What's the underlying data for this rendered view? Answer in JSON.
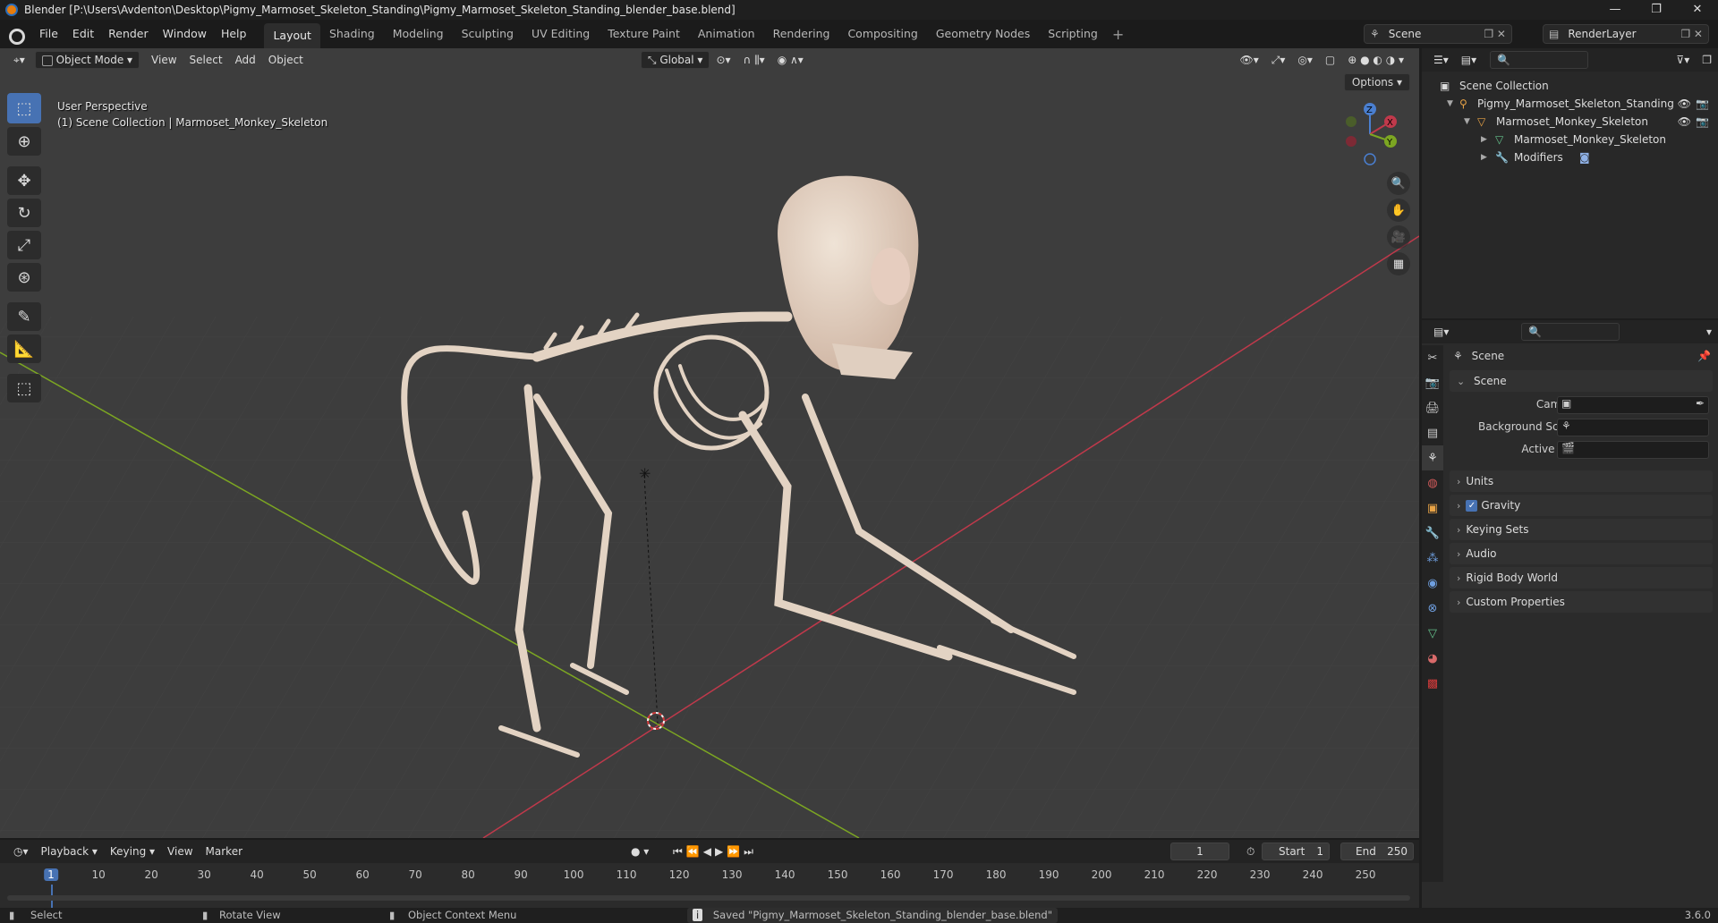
{
  "titlebar": {
    "title": "Blender [P:\\Users\\Avdenton\\Desktop\\Pigmy_Marmoset_Skeleton_Standing\\Pigmy_Marmoset_Skeleton_Standing_blender_base.blend]",
    "minimize": "—",
    "maximize": "❐",
    "close": "✕"
  },
  "menu": {
    "file": "File",
    "edit": "Edit",
    "render": "Render",
    "window": "Window",
    "help": "Help"
  },
  "workspaces": [
    "Layout",
    "Shading",
    "Modeling",
    "Sculpting",
    "UV Editing",
    "Texture Paint",
    "Animation",
    "Rendering",
    "Compositing",
    "Geometry Nodes",
    "Scripting"
  ],
  "active_workspace": "Layout",
  "scene_selector": {
    "scene": "Scene",
    "view_layer": "RenderLayer"
  },
  "viewport": {
    "mode": "Object Mode",
    "menus": [
      "View",
      "Select",
      "Add",
      "Object"
    ],
    "transform_orientation": "Global",
    "options": "Options",
    "perspective_label": "User Perspective",
    "collection_label": "(1) Scene Collection | Marmoset_Monkey_Skeleton",
    "gizmo_axes": {
      "x": "X",
      "y": "Y",
      "z": "Z"
    },
    "colors": {
      "background": "#3d3d3d",
      "x_axis": "#c0394b",
      "y_axis": "#7ca622",
      "active_tool": "#4772b3"
    }
  },
  "tool_icons": [
    "select-box-icon",
    "cursor-icon",
    "move-icon",
    "rotate-icon",
    "scale-icon",
    "transform-icon",
    "annotate-icon",
    "measure-icon",
    "add-cube-icon"
  ],
  "outliner": {
    "root": "Scene Collection",
    "items": [
      {
        "label": "Pigmy_Marmoset_Skeleton_Standing",
        "type": "armature"
      },
      {
        "label": "Marmoset_Monkey_Skeleton",
        "type": "object"
      },
      {
        "label": "Marmoset_Monkey_Skeleton",
        "type": "mesh-data"
      },
      {
        "label": "Modifiers",
        "type": "modifiers"
      }
    ]
  },
  "properties": {
    "context": "Scene",
    "panel": "Scene",
    "fields": [
      {
        "label": "Camera",
        "value": ""
      },
      {
        "label": "Background Scene",
        "value": ""
      },
      {
        "label": "Active Clip",
        "value": ""
      }
    ],
    "sections": [
      "Units",
      "Gravity",
      "Keying Sets",
      "Audio",
      "Rigid Body World",
      "Custom Properties"
    ],
    "gravity_enabled": true
  },
  "timeline": {
    "menus": [
      "Playback",
      "Keying",
      "View",
      "Marker"
    ],
    "current_frame": "1",
    "start_label": "Start",
    "start": "1",
    "end_label": "End",
    "end": "250",
    "ticks": [
      "1",
      "10",
      "20",
      "30",
      "40",
      "50",
      "60",
      "70",
      "80",
      "90",
      "100",
      "110",
      "120",
      "130",
      "140",
      "150",
      "160",
      "170",
      "180",
      "190",
      "200",
      "210",
      "220",
      "230",
      "240",
      "250"
    ]
  },
  "statusbar": {
    "select": "Select",
    "rotate": "Rotate View",
    "context_menu": "Object Context Menu",
    "message": "Saved \"Pigmy_Marmoset_Skeleton_Standing_blender_base.blend\"",
    "version": "3.6.0"
  }
}
